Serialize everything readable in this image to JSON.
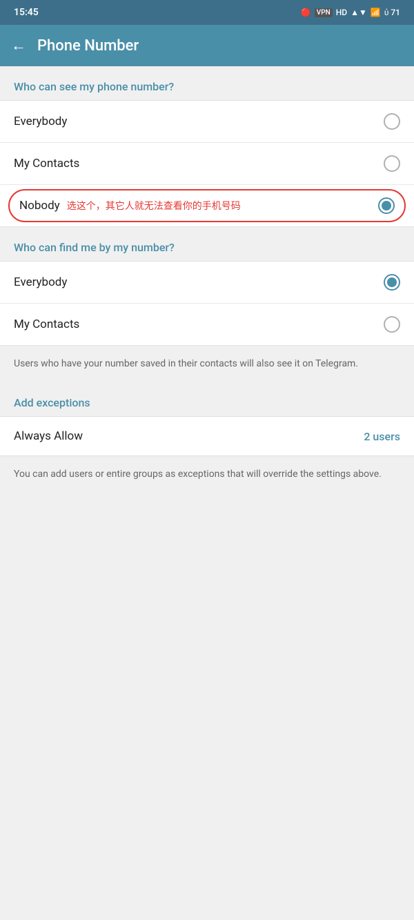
{
  "statusBar": {
    "time": "15:45",
    "icons": "🔷 VPN HD ▲ ▼ ⓘ 71"
  },
  "header": {
    "back_icon": "←",
    "title": "Phone Number"
  },
  "section1": {
    "label": "Who can see my phone number?",
    "options": [
      {
        "id": "everybody1",
        "label": "Everybody",
        "selected": false
      },
      {
        "id": "mycontacts1",
        "label": "My Contacts",
        "selected": false
      },
      {
        "id": "nobody",
        "label": "Nobody",
        "annotation": "选这个，其它人就无法查看你的手机号码",
        "selected": true
      }
    ]
  },
  "section2": {
    "label": "Who can find me by my number?",
    "options": [
      {
        "id": "everybody2",
        "label": "Everybody",
        "selected": true
      },
      {
        "id": "mycontacts2",
        "label": "My Contacts",
        "selected": false
      }
    ],
    "info": "Users who have your number saved in their contacts will also see it on Telegram."
  },
  "exceptions": {
    "label": "Add exceptions",
    "always_allow": {
      "label": "Always Allow",
      "value": "2 users"
    },
    "info": "You can add users or entire groups as exceptions that will override the settings above."
  }
}
